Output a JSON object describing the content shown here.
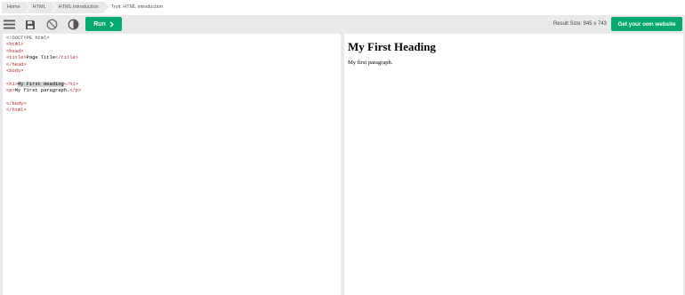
{
  "breadcrumbs": [
    {
      "label": "Home"
    },
    {
      "label": "HTML"
    },
    {
      "label": "HTML Introduction"
    }
  ],
  "breadcrumb_current": "Tryit: HTML introduction",
  "toolbar": {
    "icons": [
      "menu-icon",
      "save-icon",
      "no-symbol-icon",
      "contrast-icon"
    ],
    "run_label": "Run",
    "result_size": "Result Size: 945 x 743",
    "own_website_label": "Get your own website"
  },
  "editor": {
    "lines": [
      {
        "parts": [
          {
            "t": "<!DOCTYPE html>",
            "c": "doctype"
          }
        ]
      },
      {
        "parts": [
          {
            "t": "<html>",
            "c": "tag"
          }
        ]
      },
      {
        "parts": [
          {
            "t": "<head>",
            "c": "tag"
          }
        ]
      },
      {
        "parts": [
          {
            "t": "<title>",
            "c": "tag"
          },
          {
            "t": "Page Title",
            "c": "txt"
          },
          {
            "t": "</title>",
            "c": "tag"
          }
        ]
      },
      {
        "parts": [
          {
            "t": "</head>",
            "c": "tag"
          }
        ]
      },
      {
        "parts": [
          {
            "t": "<body>",
            "c": "tag"
          }
        ]
      },
      {
        "parts": []
      },
      {
        "parts": [
          {
            "t": "<h1>",
            "c": "tag"
          },
          {
            "t": "My First Heading",
            "c": "txt sel"
          },
          {
            "t": "</h1>",
            "c": "tag"
          }
        ]
      },
      {
        "parts": [
          {
            "t": "<p>",
            "c": "tag"
          },
          {
            "t": "My first paragraph.",
            "c": "txt"
          },
          {
            "t": "</p>",
            "c": "tag"
          }
        ]
      },
      {
        "parts": []
      },
      {
        "parts": [
          {
            "t": "</body>",
            "c": "tag"
          }
        ]
      },
      {
        "parts": [
          {
            "t": "</html>",
            "c": "tag"
          }
        ]
      }
    ]
  },
  "result": {
    "heading": "My First Heading",
    "paragraph": "My first paragraph."
  },
  "colors": {
    "accent": "#04aa6d",
    "tag": "#a52a2a",
    "chrome": "#e7e9eb"
  }
}
